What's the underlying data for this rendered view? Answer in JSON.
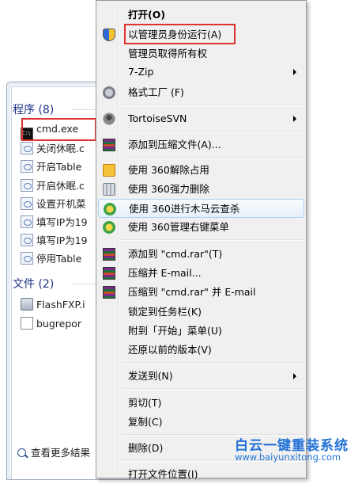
{
  "search_panel": {
    "groups": [
      {
        "title": "程序 (8)",
        "items": [
          {
            "label": "cmd.exe",
            "icon": "cmd-icon"
          },
          {
            "label": "关闭休眠.c",
            "icon": "batch-file-icon"
          },
          {
            "label": "开启Table",
            "icon": "batch-file-icon"
          },
          {
            "label": "开启休眠.c",
            "icon": "batch-file-icon"
          },
          {
            "label": "设置开机菜",
            "icon": "batch-file-icon"
          },
          {
            "label": "填写IP为19",
            "icon": "batch-file-icon"
          },
          {
            "label": "填写IP为19",
            "icon": "batch-file-icon"
          },
          {
            "label": "停用Table",
            "icon": "batch-file-icon"
          }
        ]
      },
      {
        "title": "文件 (2)",
        "items": [
          {
            "label": "FlashFXP.i",
            "icon": "exe-icon"
          },
          {
            "label": "bugrepor",
            "icon": "file-icon"
          }
        ]
      }
    ],
    "see_more": "查看更多结果"
  },
  "context_menu": {
    "items": [
      {
        "label": "打开(O)",
        "bold": true,
        "icon": ""
      },
      {
        "label": "以管理员身份运行(A)",
        "icon": "uac-shield-icon"
      },
      {
        "label": "管理员取得所有权",
        "icon": ""
      },
      {
        "label": "7-Zip",
        "icon": "",
        "submenu": true
      },
      {
        "label": "格式工厂 (F)",
        "icon": "gear-icon"
      },
      {
        "label": "TortoiseSVN",
        "icon": "tortoisesvn-icon",
        "submenu": true
      },
      {
        "label": "添加到压缩文件(A)...",
        "icon": "winrar-icon"
      },
      {
        "label": "使用 360解除占用",
        "icon": "360-unlock-icon"
      },
      {
        "label": "使用 360强力删除",
        "icon": "360-shred-icon"
      },
      {
        "label": "使用 360进行木马云查杀",
        "icon": "360-scan-icon",
        "hover": true
      },
      {
        "label": "使用 360管理右键菜单",
        "icon": "360-scan-icon"
      },
      {
        "label": "添加到 \"cmd.rar\"(T)",
        "icon": "winrar-icon"
      },
      {
        "label": "压缩并 E-mail...",
        "icon": "winrar-icon"
      },
      {
        "label": "压缩到 \"cmd.rar\" 并 E-mail",
        "icon": "winrar-icon"
      },
      {
        "label": "锁定到任务栏(K)",
        "icon": ""
      },
      {
        "label": "附到「开始」菜单(U)",
        "icon": ""
      },
      {
        "label": "还原以前的版本(V)",
        "icon": ""
      },
      {
        "label": "发送到(N)",
        "icon": "",
        "submenu": true
      },
      {
        "label": "剪切(T)",
        "icon": ""
      },
      {
        "label": "复制(C)",
        "icon": ""
      },
      {
        "label": "删除(D)",
        "icon": ""
      },
      {
        "label": "打开文件位置(I)",
        "icon": ""
      }
    ]
  },
  "watermark": {
    "title": "白云一键重装系统",
    "url": "www.baiyunxitong.com"
  },
  "colors": {
    "highlight_box": "#e03131",
    "group_title": "#1e3287",
    "watermark": "#2272d6",
    "menu_bg": "#f0f0f0"
  }
}
